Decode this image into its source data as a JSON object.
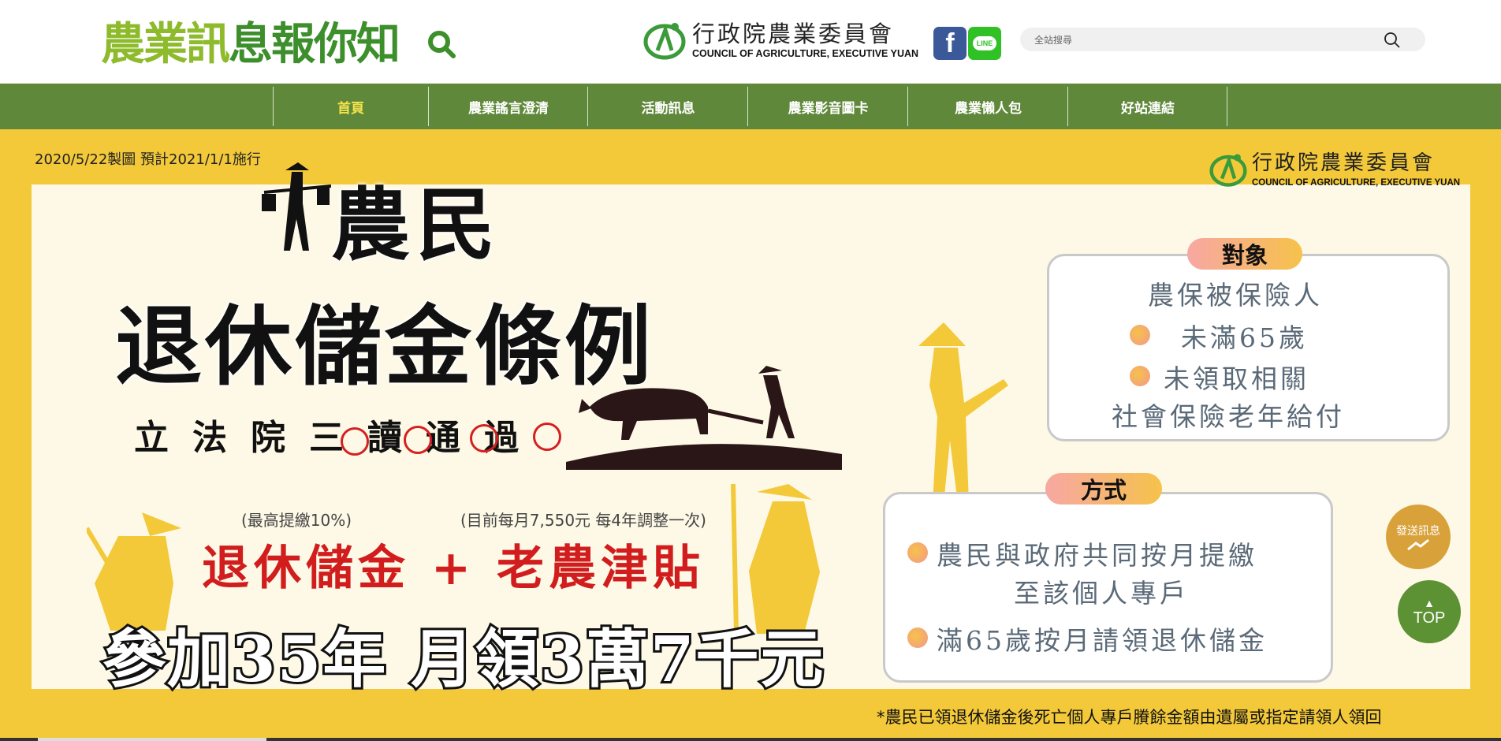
{
  "header": {
    "logo_text_a": "農業訊",
    "logo_text_b": "息報你知",
    "coa_name_zh": "行政院農業委員會",
    "coa_name_en": "COUNCIL OF AGRICULTURE, EXECUTIVE YUAN",
    "facebook_label": "f",
    "line_label": "LINE",
    "search_placeholder": "全站搜尋"
  },
  "nav": {
    "items": [
      {
        "label": "首頁",
        "active": true
      },
      {
        "label": "農業謠言澄清"
      },
      {
        "label": "活動訊息"
      },
      {
        "label": "農業影音圖卡"
      },
      {
        "label": "農業懶人包"
      },
      {
        "label": "好站連結"
      }
    ]
  },
  "banner": {
    "meta": "2020/5/22製圖 預計2021/1/1施行",
    "title_line1": "農民",
    "title_line2": "退休儲金條例",
    "passed": "立法院三讀通過",
    "note_left": "(最高提繳10%)",
    "note_right": "(目前每月7,550元 每4年調整一次)",
    "formula": "退休儲金 + 老農津貼",
    "bottom": "參加35年 月領3萬7千元",
    "target_tag": "對象",
    "target_lines": [
      "農保被保險人",
      "未滿65歲",
      "未領取相關",
      "社會保險老年給付"
    ],
    "method_tag": "方式",
    "method_lines": [
      "農民與政府共同按月提繳",
      "至該個人專戶",
      "滿65歲按月請領退休儲金"
    ],
    "footnote": "*農民已領退休儲金後死亡個人專戶賸餘金額由遺屬或指定請領人領回"
  },
  "floating": {
    "send_label": "發送訊息",
    "top_label": "TOP"
  },
  "colors": {
    "nav_bg": "#60883a",
    "nav_active": "#f4e24c",
    "banner_bg": "#f3c93a",
    "accent_red": "#d11d1d"
  }
}
